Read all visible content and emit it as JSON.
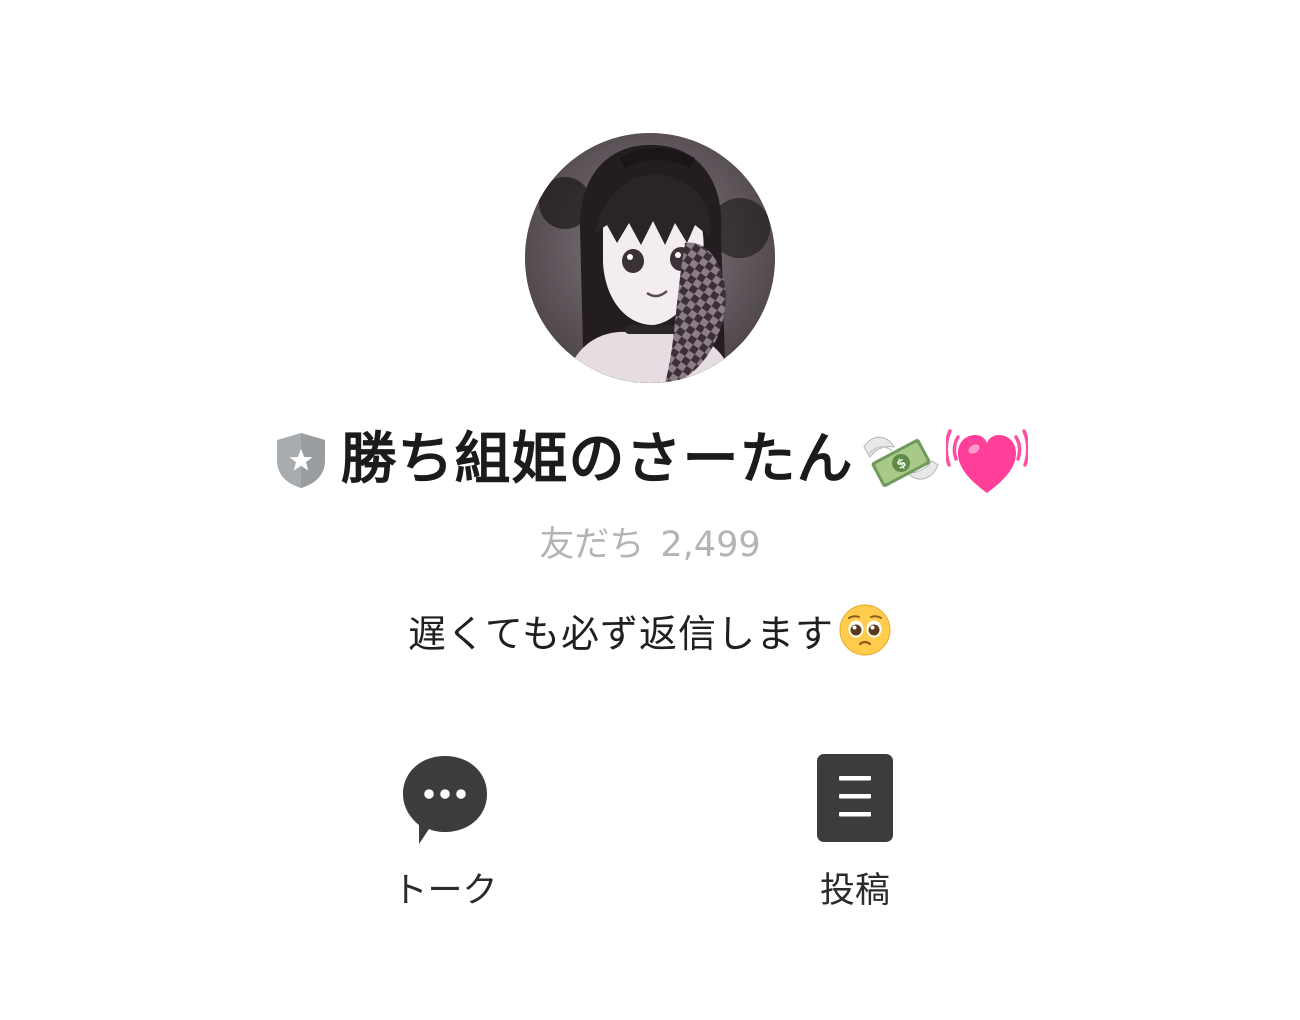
{
  "profile": {
    "name": "勝ち組姫のさーたん",
    "friends_label": "友だち",
    "friends_count": "2,499",
    "status_message": "遅くても必ず返信します"
  },
  "icons": {
    "badge": "gray-shield-star-icon",
    "name_emoji_1": "money-with-wings-emoji",
    "name_emoji_2": "beating-heart-emoji",
    "status_emoji": "pleading-face-emoji",
    "talk": "speech-bubble-dots-icon",
    "posts": "document-lines-icon"
  },
  "actions": {
    "talk_label": "トーク",
    "posts_label": "投稿"
  },
  "colors": {
    "icon_dark": "#3c3c3c",
    "friends_text": "#b4b4b4",
    "badge_gray": "#a9acaf",
    "heart_pink": "#ff3f9a"
  }
}
